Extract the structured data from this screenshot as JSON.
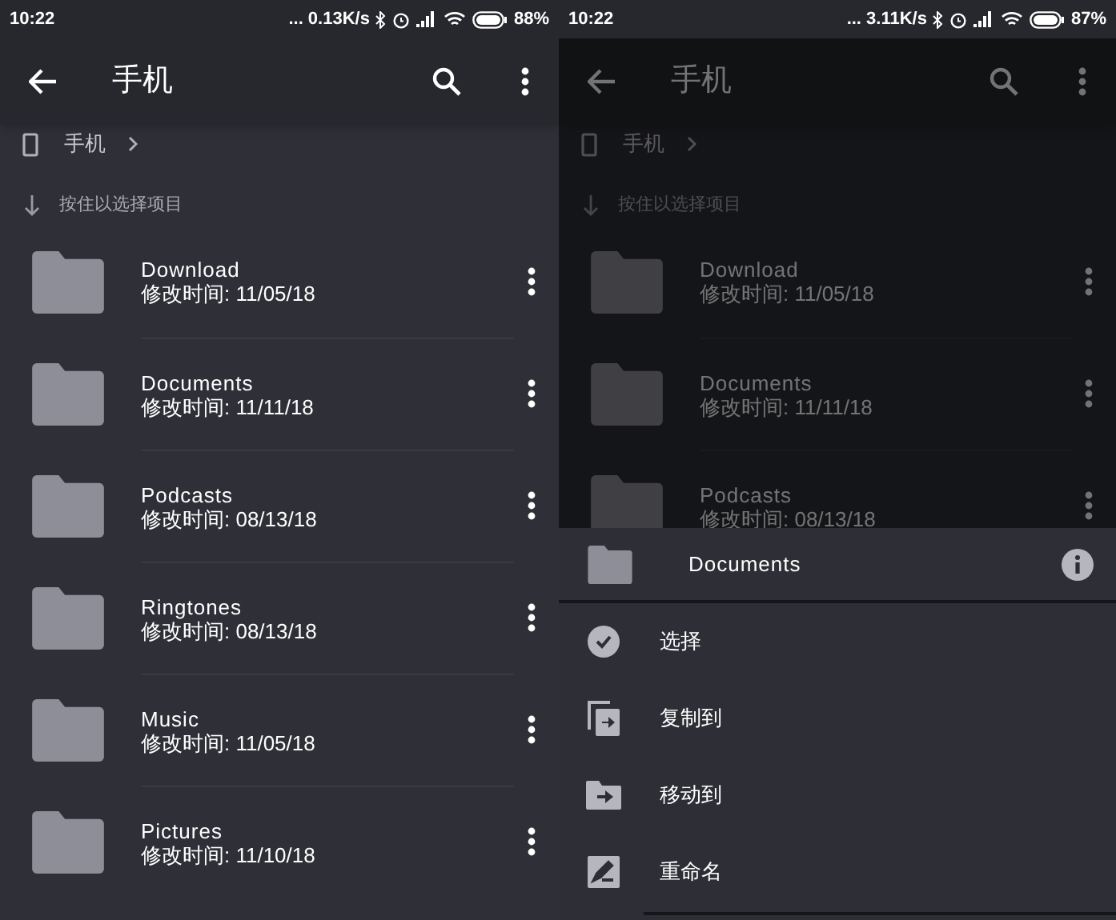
{
  "screens": [
    {
      "status_bar": {
        "time": "10:22",
        "speed": "... 0.13K/s",
        "battery": "88%"
      },
      "title": "手机",
      "breadcrumb": "手机",
      "hint": "按住以选择项目",
      "dimmed": false,
      "items": [
        {
          "name": "Download",
          "modified": "修改时间: 11/05/18"
        },
        {
          "name": "Documents",
          "modified": "修改时间: 11/11/18"
        },
        {
          "name": "Podcasts",
          "modified": "修改时间: 08/13/18"
        },
        {
          "name": "Ringtones",
          "modified": "修改时间: 08/13/18"
        },
        {
          "name": "Music",
          "modified": "修改时间: 11/05/18"
        },
        {
          "name": "Pictures",
          "modified": "修改时间: 11/10/18"
        }
      ]
    },
    {
      "status_bar": {
        "time": "10:22",
        "speed": "... 3.11K/s",
        "battery": "87%"
      },
      "title": "手机",
      "breadcrumb": "手机",
      "hint": "按住以选择项目",
      "dimmed": true,
      "items": [
        {
          "name": "Download",
          "modified": "修改时间: 11/05/18"
        },
        {
          "name": "Documents",
          "modified": "修改时间: 11/11/18"
        },
        {
          "name": "Podcasts",
          "modified": "修改时间: 08/13/18"
        }
      ],
      "sheet": {
        "title": "Documents",
        "actions": [
          {
            "kind": "select",
            "label": "选择"
          },
          {
            "kind": "copy",
            "label": "复制到"
          },
          {
            "kind": "move",
            "label": "移动到"
          },
          {
            "kind": "rename",
            "label": "重命名"
          }
        ]
      }
    }
  ]
}
